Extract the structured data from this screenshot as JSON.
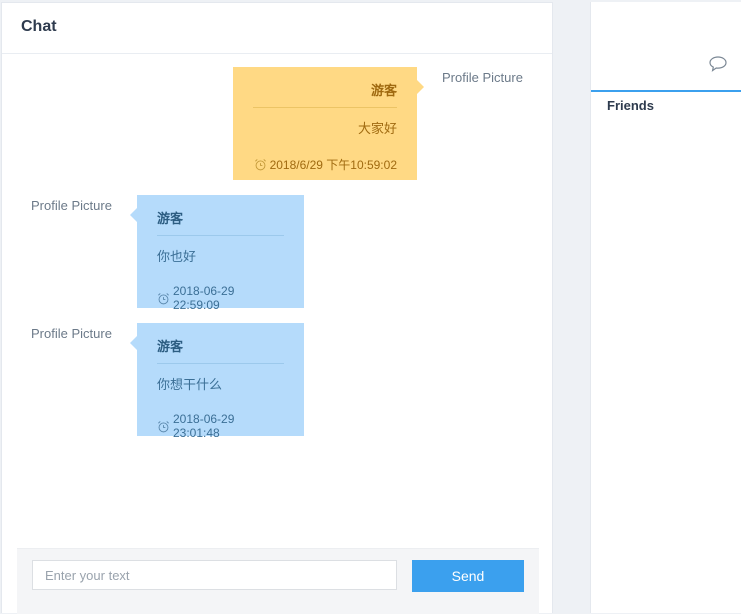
{
  "chat": {
    "title": "Chat",
    "messages": [
      {
        "direction": "me",
        "avatar_label": "Profile Picture",
        "sender": "游客",
        "text": "大家好",
        "time": "2018/6/29 下午10:59:02"
      },
      {
        "direction": "other",
        "avatar_label": "Profile Picture",
        "sender": "游客",
        "text": "你也好",
        "time": "2018-06-29 22:59:09"
      },
      {
        "direction": "other",
        "avatar_label": "Profile Picture",
        "sender": "游客",
        "text": "你想干什么",
        "time": "2018-06-29 23:01:48"
      }
    ],
    "composer": {
      "placeholder": "Enter your text",
      "value": "",
      "send_label": "Send"
    }
  },
  "sidebar": {
    "tab_icon": "chat-bubble-icon",
    "section_title": "Friends"
  },
  "icons": {
    "message_time": "alarm-clock-icon"
  },
  "colors": {
    "accent": "#3ba0ee",
    "my_bubble": "#ffd984",
    "other_bubble": "#b5dbfb"
  }
}
